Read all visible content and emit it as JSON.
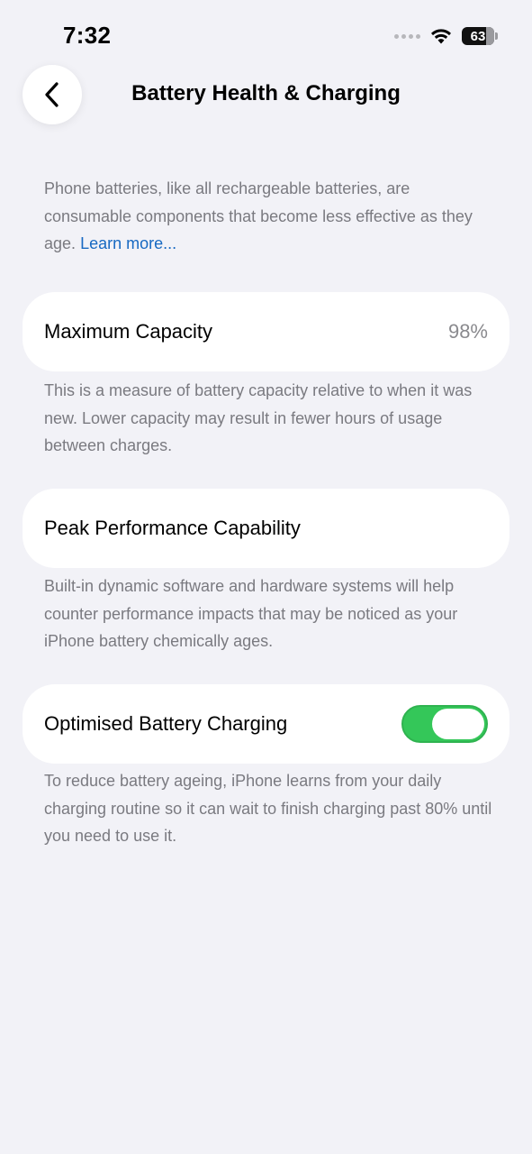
{
  "status_bar": {
    "time": "7:32",
    "battery_level": "63",
    "icons": [
      "signal-dots-icon",
      "wifi-icon",
      "battery-icon"
    ]
  },
  "header": {
    "title": "Battery Health & Charging",
    "back_icon": "chevron-left-icon"
  },
  "intro": {
    "text": "Phone batteries, like all rechargeable batteries, are consumable components that become less effective as they age.",
    "link": "Learn more..."
  },
  "maximum_capacity": {
    "label": "Maximum Capacity",
    "value": "98%",
    "description": "This is a measure of battery capacity relative to when it was new. Lower capacity may result in fewer hours of usage between charges."
  },
  "peak_performance": {
    "label": "Peak Performance Capability",
    "description": "Built-in dynamic software and hardware systems will help counter performance impacts that may be noticed as your iPhone battery chemically ages."
  },
  "optimised_charging": {
    "label": "Optimised Battery Charging",
    "enabled": true,
    "description": "To reduce battery ageing, iPhone learns from your daily charging routine so it can wait to finish charging past 80% until you need to use it."
  },
  "colors": {
    "background": "#f2f2f7",
    "toggle_on": "#34c759",
    "link": "#1769c2",
    "secondary_text": "#7a7a80"
  }
}
